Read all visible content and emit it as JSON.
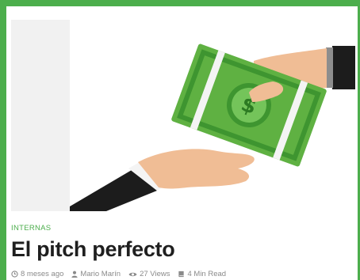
{
  "post": {
    "category": "INTERNAS",
    "title": "El pitch perfecto",
    "meta": {
      "date": "8 meses ago",
      "author": "Mario Marín",
      "views": "27 Views",
      "read_time": "4 Min Read"
    }
  },
  "colors": {
    "accent": "#4cae4c",
    "title": "#1f1f1f",
    "meta": "#8a8a8a"
  }
}
